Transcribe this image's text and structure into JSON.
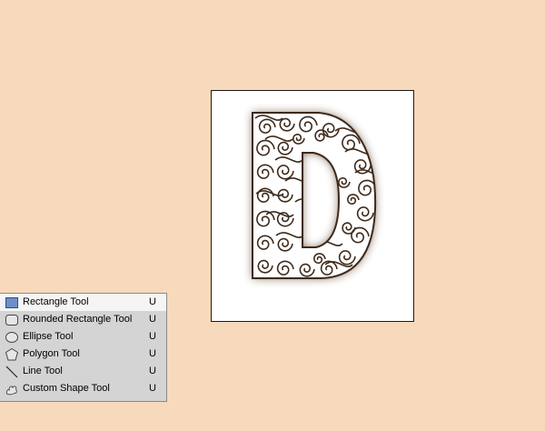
{
  "document": {
    "artwork": "ornamental-letter-d"
  },
  "shape_tool_menu": {
    "items": [
      {
        "label": "Rectangle Tool",
        "shortcut": "U",
        "icon": "rectangle-icon",
        "selected": true
      },
      {
        "label": "Rounded Rectangle Tool",
        "shortcut": "U",
        "icon": "rounded-rectangle-icon",
        "selected": false
      },
      {
        "label": "Ellipse Tool",
        "shortcut": "U",
        "icon": "ellipse-icon",
        "selected": false
      },
      {
        "label": "Polygon Tool",
        "shortcut": "U",
        "icon": "polygon-icon",
        "selected": false
      },
      {
        "label": "Line Tool",
        "shortcut": "U",
        "icon": "line-icon",
        "selected": false
      },
      {
        "label": "Custom Shape Tool",
        "shortcut": "U",
        "icon": "custom-shape-icon",
        "selected": false
      }
    ]
  },
  "colors": {
    "background": "#f7d9bb",
    "menu_bg": "#d4d4d4",
    "menu_selected": "#f5f5f5",
    "ornament": "#4a3324"
  }
}
